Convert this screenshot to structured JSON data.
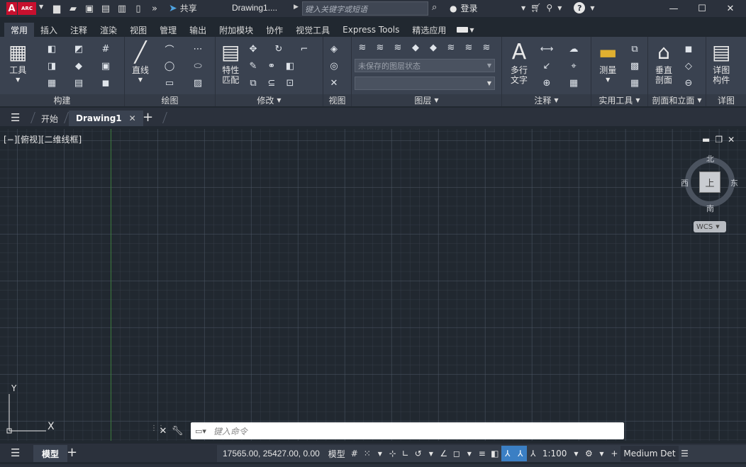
{
  "titlebar": {
    "logo_letter": "A",
    "logo_sub": "ARC",
    "share_label": "共享",
    "document_title": "Drawing1....",
    "search_placeholder": "键入关键字或短语",
    "login_label": "登录"
  },
  "ribbon_tabs": [
    "常用",
    "插入",
    "注释",
    "渲染",
    "视图",
    "管理",
    "输出",
    "附加模块",
    "协作",
    "视觉工具",
    "Express Tools",
    "精选应用"
  ],
  "ribbon": {
    "panels": {
      "build": "构建",
      "draw": "绘图",
      "modify": "修改",
      "view": "视图",
      "layers": "图层",
      "annotation": "注释",
      "utilities": "实用工具",
      "section": "剖面和立面",
      "details": "详图"
    },
    "buttons": {
      "tools": "工具",
      "line": "直线",
      "match_properties_1": "特性",
      "match_properties_2": "匹配",
      "multiline_text_1": "多行",
      "multiline_text_2": "文字",
      "measure": "测量",
      "vertical_section_1": "垂直",
      "vertical_section_2": "剖面",
      "detail_component_1": "详图",
      "detail_component_2": "构件"
    },
    "layer_state_placeholder": "未保存的图层状态",
    "layer_select_value": ""
  },
  "filetabs": {
    "start": "开始",
    "drawing": "Drawing1"
  },
  "canvas": {
    "viewport_label": "[−][俯视][二维线框]",
    "compass": {
      "north": "北",
      "south": "南",
      "east": "东",
      "west": "西"
    },
    "cube_face": "上",
    "wcs_label": "WCS",
    "ucs_y": "Y",
    "ucs_x": "X"
  },
  "command": {
    "placeholder": "键入命令"
  },
  "statusbar": {
    "layout_tab": "模型",
    "coordinates": "17565.00, 25427.00, 0.00",
    "model_label": "模型",
    "scale": "1:100",
    "detail_level": "Medium Det"
  },
  "colors": {
    "accent": "#3b7fc4",
    "brand": "#c8102e",
    "canvas_bg": "#212830"
  }
}
